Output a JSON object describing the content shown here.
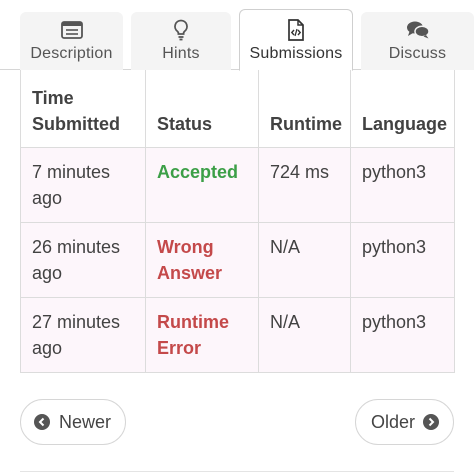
{
  "tabs": [
    {
      "label": "Description",
      "icon": "document-icon",
      "active": false
    },
    {
      "label": "Hints",
      "icon": "lightbulb-icon",
      "active": false
    },
    {
      "label": "Submissions",
      "icon": "code-file-icon",
      "active": true
    },
    {
      "label": "Discuss",
      "icon": "chat-bubbles-icon",
      "active": false
    }
  ],
  "table": {
    "headers": [
      "Time Submitted",
      "Status",
      "Runtime",
      "Language"
    ],
    "rows": [
      {
        "time": "7 minutes ago",
        "status": "Accepted",
        "runtime": "724 ms",
        "language": "python3"
      },
      {
        "time": "26 minutes ago",
        "status": "Wrong Answer",
        "runtime": "N/A",
        "language": "python3"
      },
      {
        "time": "27 minutes ago",
        "status": "Runtime Error",
        "runtime": "N/A",
        "language": "python3"
      }
    ]
  },
  "pagination": {
    "newer_label": "Newer",
    "older_label": "Older"
  },
  "colors": {
    "accepted": "#3c9f47",
    "error": "#c4494a",
    "row_bg": "#fdf6fb"
  }
}
